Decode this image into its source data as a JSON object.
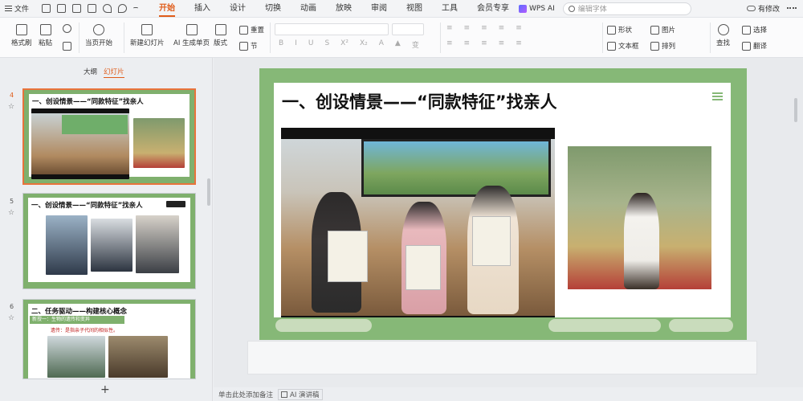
{
  "menubar": {
    "file_label": "文件",
    "tabs": [
      "开始",
      "插入",
      "设计",
      "切换",
      "动画",
      "放映",
      "审阅",
      "视图",
      "工具",
      "会员专享"
    ],
    "active_tab": "开始",
    "wps_ai_label": "WPS AI",
    "search_placeholder": "编辑字体",
    "modified_label": "有修改"
  },
  "ribbon": {
    "format_painter": "格式刷",
    "paste": "粘贴",
    "play_from_current": "当页开始",
    "new_slide": "新建幻灯片",
    "ai_generate": "AI 生成单页",
    "layout": "版式",
    "reset": "重置",
    "section": "节",
    "shape": "形状",
    "image": "图片",
    "textbox": "文本框",
    "arrange": "排列",
    "find": "查找",
    "select": "选择",
    "translate": "翻译"
  },
  "left_panel": {
    "tab_outline": "大纲",
    "tab_slides": "幻灯片",
    "slides": [
      {
        "number": "4",
        "title": "一、创设情景——“同款特征”找亲人"
      },
      {
        "number": "5",
        "title": "一、创设情景——“同款特征”找亲人"
      },
      {
        "number": "6",
        "title": "二、任务驱动——构建核心概念",
        "sub1": "新授一：生物的遗传和变异",
        "sub2": "遗传：是指亲子代间的相似性。"
      }
    ],
    "add_label": "+"
  },
  "main_slide": {
    "title": "一、创设情景——“同款特征”找亲人"
  },
  "statusbar": {
    "notes_hint": "单击此处添加备注",
    "ai_speech": "AI 演讲稿"
  },
  "colors": {
    "accent": "#e05c1a",
    "slide_green": "#86b877"
  }
}
